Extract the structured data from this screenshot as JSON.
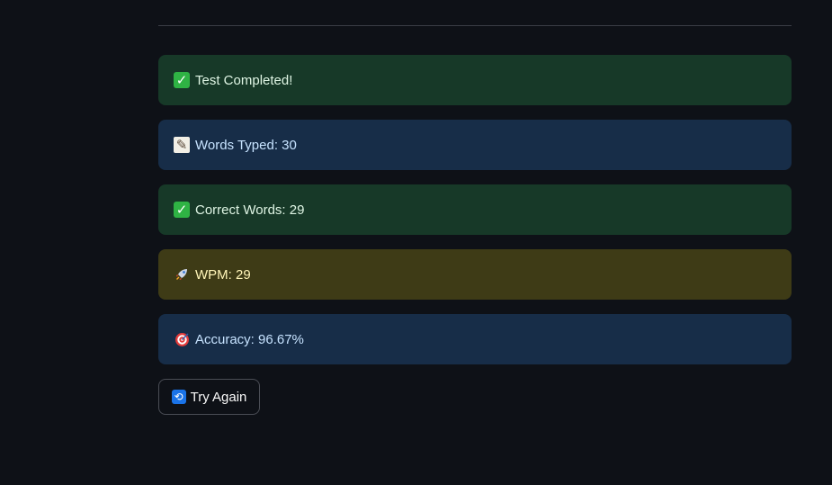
{
  "results": {
    "completed": {
      "icon": "check-mark-icon",
      "text": "Test Completed!"
    },
    "words_typed": {
      "icon": "memo-icon",
      "text": "Words Typed: 30"
    },
    "correct_words": {
      "icon": "check-mark-icon",
      "text": "Correct Words: 29"
    },
    "wpm": {
      "icon": "rocket-icon",
      "text": "WPM: 29"
    },
    "accuracy": {
      "icon": "target-icon",
      "text": "Accuracy: 96.67%"
    }
  },
  "actions": {
    "try_again": {
      "icon": "repeat-icon",
      "label": "Try Again"
    }
  },
  "colors": {
    "background": "#0e1117",
    "success": "#173928",
    "info": "#172d48",
    "warning": "#3e3b16"
  }
}
